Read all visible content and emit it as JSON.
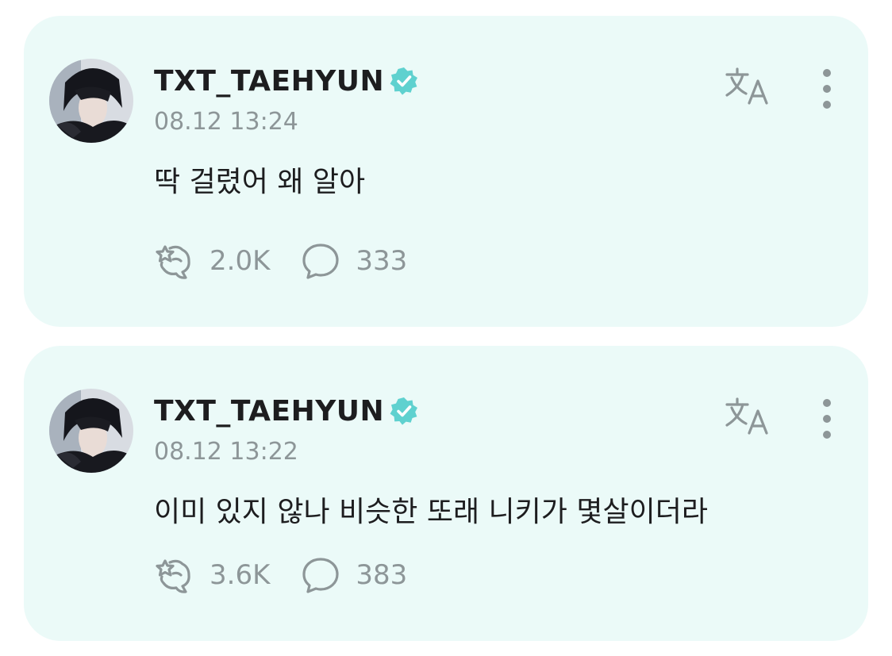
{
  "colors": {
    "card_background": "#ebfaf8",
    "accent": "#5fd1cf",
    "muted_text": "#8d9698",
    "primary_text": "#1d1d1f"
  },
  "icons": {
    "verified": "verified-badge-icon",
    "translate": "translate-icon",
    "more": "more-vertical-icon",
    "cheer": "cheer-hand-icon",
    "comment": "comment-bubble-icon"
  },
  "posts": [
    {
      "username": "TXT_TAEHYUN",
      "timestamp": "08.12 13:24",
      "text": "딱 걸렸어 왜 알아",
      "likes": "2.0K",
      "comments": "333"
    },
    {
      "username": "TXT_TAEHYUN",
      "timestamp": "08.12 13:22",
      "text": "이미 있지 않나 비슷한 또래 니키가 몇살이더라",
      "likes": "3.6K",
      "comments": "383"
    }
  ]
}
